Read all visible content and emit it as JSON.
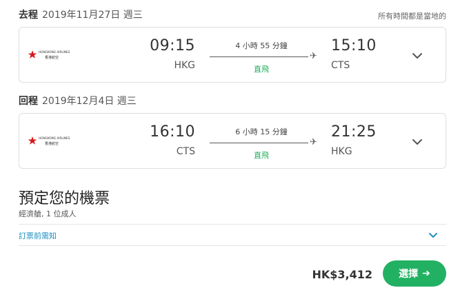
{
  "timezone_note": "所有時間都是當地的",
  "legs": [
    {
      "label": "去程",
      "date": "2019年11月27日 週三",
      "airline_logo": "hong-kong-airlines-logo",
      "airline_name": "HONGKONG AIRLINES",
      "airline_name_zh": "香港航空",
      "dep_time": "09:15",
      "dep_code": "HKG",
      "duration": "4 小時 55 分鐘",
      "stops": "直飛",
      "arr_time": "15:10",
      "arr_code": "CTS"
    },
    {
      "label": "回程",
      "date": "2019年12月4日 週三",
      "airline_logo": "hong-kong-airlines-logo",
      "airline_name": "HONGKONG AIRLINES",
      "airline_name_zh": "香港航空",
      "dep_time": "16:10",
      "dep_code": "CTS",
      "duration": "6 小時 15 分鐘",
      "stops": "直飛",
      "arr_time": "21:25",
      "arr_code": "HKG"
    }
  ],
  "booking": {
    "title": "預定您的機票",
    "subtitle": "經濟艙, 1 位成人",
    "notice_link": "訂票前需知"
  },
  "footer": {
    "price": "HK$3,412",
    "select_label": "選擇"
  },
  "colors": {
    "accent_green": "#22b163",
    "direct_green": "#1fae5a",
    "link_blue": "#1a8fc1",
    "logo_red": "#d7191f"
  },
  "icons": [
    "plane-icon",
    "chevron-down-icon",
    "arrow-right-icon"
  ]
}
